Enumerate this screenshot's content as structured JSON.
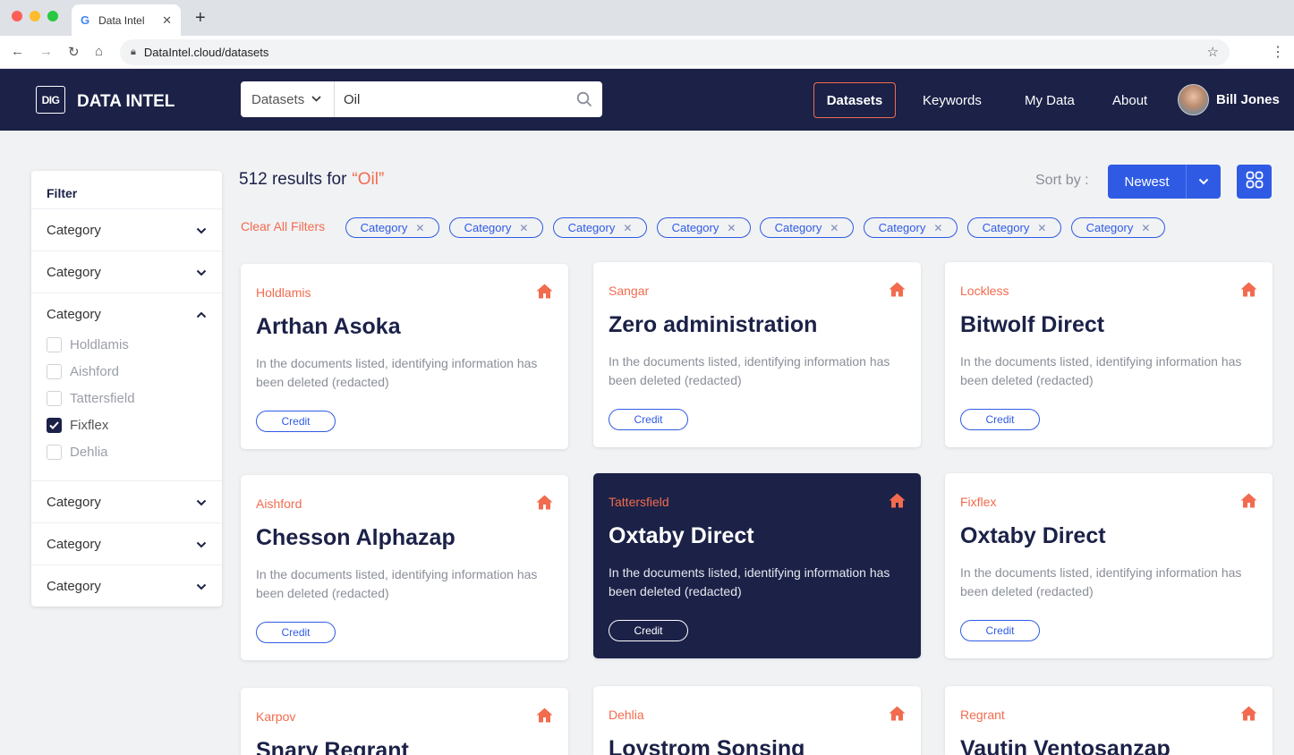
{
  "browser": {
    "tab_title": "Data Intel",
    "url": "DataIntel.cloud/datasets"
  },
  "header": {
    "logo_mark": "DIG",
    "logo_text": "DATA INTEL",
    "search_type": "Datasets",
    "search_value": "Oil",
    "nav": [
      "Datasets",
      "Keywords",
      "My Data",
      "About"
    ],
    "user_name": "Bill Jones"
  },
  "filter": {
    "title": "Filter",
    "groups": [
      "Category",
      "Category",
      "Category",
      "Category",
      "Category",
      "Category"
    ],
    "options": [
      {
        "label": "Holdlamis",
        "checked": false
      },
      {
        "label": "Aishford",
        "checked": false
      },
      {
        "label": "Tattersfield",
        "checked": false
      },
      {
        "label": "Fixflex",
        "checked": true
      },
      {
        "label": "Dehlia",
        "checked": false
      }
    ]
  },
  "results": {
    "count_text": "512 results for",
    "query": "“Oil”",
    "sort_label": "Sort by :",
    "sort_value": "Newest",
    "clear_label": "Clear All Filters",
    "chips": [
      "Category",
      "Category",
      "Category",
      "Category",
      "Category",
      "Category",
      "Category",
      "Category"
    ]
  },
  "cards": [
    {
      "company": "Holdlamis",
      "title": "Arthan Asoka",
      "desc": "In the documents listed, identifying information has been deleted (redacted)",
      "cta": "Credit"
    },
    {
      "company": "Sangar",
      "title": "Zero administration",
      "desc": "In the documents listed, identifying information has been deleted (redacted)",
      "cta": "Credit"
    },
    {
      "company": "Lockless",
      "title": "Bitwolf Direct",
      "desc": "In the documents listed, identifying information has been deleted (redacted)",
      "cta": "Credit"
    },
    {
      "company": "Aishford",
      "title": "Chesson Alphazap",
      "desc": "In the documents listed, identifying information has been deleted (redacted)",
      "cta": "Credit"
    },
    {
      "company": "Tattersfield",
      "title": "Oxtaby Direct",
      "desc": "In the documents listed, identifying information has been deleted (redacted)",
      "cta": "Credit"
    },
    {
      "company": "Fixflex",
      "title": "Oxtaby Direct",
      "desc": "In the documents listed, identifying information has been deleted (redacted)",
      "cta": "Credit"
    },
    {
      "company": "Karpov",
      "title": "Snary Regrant",
      "desc": "",
      "cta": ""
    },
    {
      "company": "Dehlia",
      "title": "Loystrom Sonsing",
      "desc": "",
      "cta": ""
    },
    {
      "company": "Regrant",
      "title": "Vautin Ventosanzap",
      "desc": "",
      "cta": ""
    }
  ],
  "colors": {
    "navy": "#1b2147",
    "accent_orange": "#f26b4e",
    "primary_blue": "#2f5be4"
  },
  "icons": [
    "search-icon",
    "chevron-down-icon",
    "chevron-up-icon",
    "grid-view-icon",
    "home-icon",
    "close-icon",
    "star-icon",
    "lock-icon"
  ]
}
